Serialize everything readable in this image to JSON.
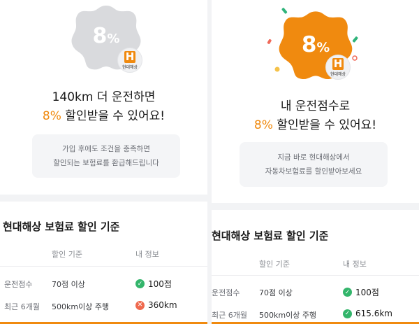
{
  "colors": {
    "accent": "#f08a0f",
    "badge_inactive": "#d9dadd",
    "ok": "#33b56b",
    "fail": "#ef6a4f"
  },
  "left": {
    "badge_value": "8",
    "badge_symbol": "%",
    "brand_logo_text": "현대해상",
    "headline_line1": "140km 더 운전하면",
    "headline_highlight": "8%",
    "headline_line2_rest": " 할인받을 수 있어요!",
    "note_line1": "가입 후에도 조건을 충족하면",
    "note_line2": "할인되는 보험료를 환급해드립니다",
    "section_title": "현대해상 보험료 할인 기준",
    "col_criteria": "할인 기준",
    "col_my_info": "내 정보",
    "rows": [
      {
        "label": "운전점수",
        "criteria": "70점 이상",
        "value": "100점",
        "status": "ok"
      },
      {
        "label": "최근 6개월",
        "criteria": "500km이상 주행",
        "value": "360km",
        "status": "fail"
      }
    ]
  },
  "right": {
    "badge_value": "8",
    "badge_symbol": "%",
    "brand_logo_text": "현대해상",
    "headline_line1": "내 운전점수로",
    "headline_highlight": "8%",
    "headline_line2_rest": " 할인받을 수 있어요!",
    "note_line1": "지금 바로 현대해상에서",
    "note_line2": "자동차보험료를 할인받아보세요",
    "section_title": "현대해상 보험료 할인 기준",
    "col_criteria": "할인 기준",
    "col_my_info": "내 정보",
    "rows": [
      {
        "label": "운전점수",
        "criteria": "70점 이상",
        "value": "100점",
        "status": "ok"
      },
      {
        "label": "최근 6개월",
        "criteria": "500km이상 주행",
        "value": "615.6km",
        "status": "ok"
      }
    ]
  }
}
